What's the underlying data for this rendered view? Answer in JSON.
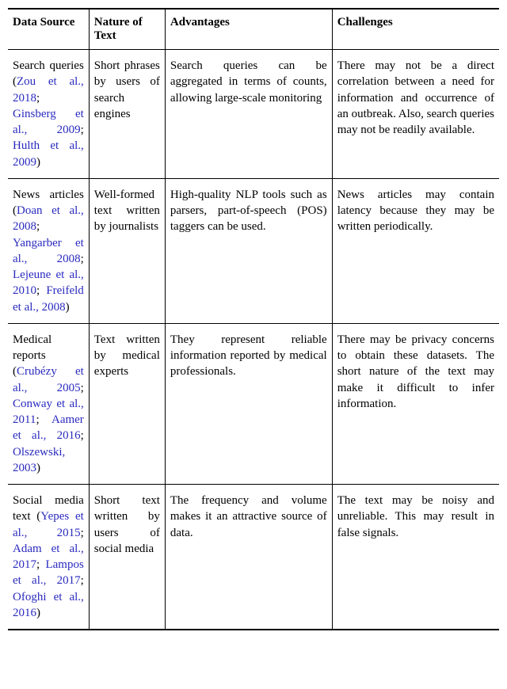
{
  "chart_data": {
    "type": "table",
    "headers": [
      "Data Source",
      "Nature of Text",
      "Advantages",
      "Challenges"
    ],
    "rows": [
      {
        "data_source": {
          "label": "Search queries",
          "citations": [
            "Zou et al., 2018",
            "Ginsberg et al., 2009",
            "Hulth et al., 2009"
          ]
        },
        "nature": "Short phrases by users of search engines",
        "advantages": "Search queries can be aggregated in terms of counts, allowing large-scale monitoring",
        "challenges": "There may not be a direct correlation between a need for information and occurrence of an outbreak. Also, search queries may not be readily available."
      },
      {
        "data_source": {
          "label": "News articles",
          "citations": [
            "Doan et al., 2008",
            "Yangarber et al., 2008",
            "Lejeune et al., 2010",
            "Freifeld et al., 2008"
          ]
        },
        "nature": "Well-formed text written by journalists",
        "advantages": "High-quality NLP tools such as parsers, part-of-speech (POS) taggers can be used.",
        "challenges": "News articles may contain latency because they may be written periodically."
      },
      {
        "data_source": {
          "label": "Medical reports",
          "citations": [
            "Crubézy et al., 2005",
            "Conway et al., 2011",
            "Aamer et al., 2016",
            "Olszewski, 2003"
          ]
        },
        "nature": "Text written by medical experts",
        "advantages": "They represent reliable information reported by medical professionals.",
        "challenges": "There may be privacy concerns to obtain these datasets. The short nature of the text may make it difficult to infer information."
      },
      {
        "data_source": {
          "label": "Social media text",
          "citations": [
            "Yepes et al., 2015",
            "Adam et al., 2017",
            "Lampos et al., 2017",
            "Ofoghi et al., 2016"
          ]
        },
        "nature": "Short text written by users of social media",
        "advantages": "The frequency and volume makes it an attractive source of data.",
        "challenges": "The text may be noisy and unreliable. This may result in false signals."
      }
    ]
  }
}
